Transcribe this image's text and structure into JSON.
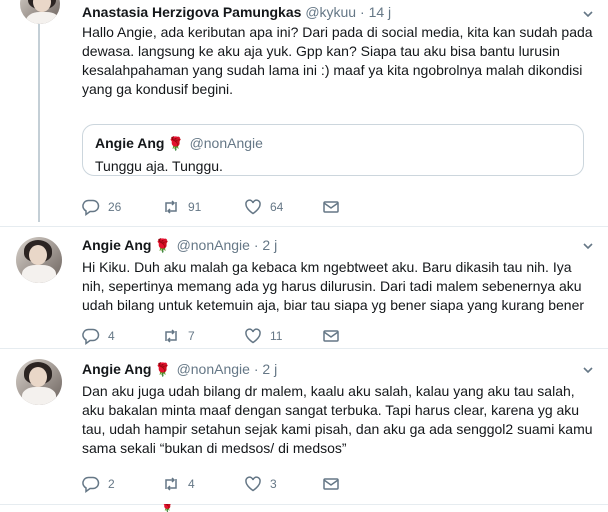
{
  "tweets": [
    {
      "name": "Anastasia Herzigova Pamungkas",
      "handle": "@kykuu",
      "time": "14 j",
      "text": "Hallo Angie, ada keributan apa ini? Dari pada di social media, kita kan sudah pada dewasa. langsung ke aku aja yuk. Gpp kan? Siapa tau aku bisa bantu lurusin kesalahpahaman yang sudah lama ini :) maaf ya kita ngobrolnya malah dikondisi yang ga kondusif begini.",
      "quote": {
        "name": "Angie Ang",
        "handle": "@nonAngie",
        "text": "Tunggu aja. Tunggu."
      },
      "replies": "26",
      "retweets": "91",
      "likes": "64"
    },
    {
      "name": "Angie Ang",
      "handle": "@nonAngie",
      "time": "2 j",
      "text": "Hi Kiku. Duh aku malah ga kebaca km ngebtweet aku. Baru dikasih tau nih. Iya nih, sepertinya memang ada yg harus dilurusin. Dari tadi malem sebenernya aku udah bilang untuk ketemuin aja, biar tau siapa yg bener siapa yang kurang bener",
      "replies": "4",
      "retweets": "7",
      "likes": "11"
    },
    {
      "name": "Angie Ang",
      "handle": "@nonAngie",
      "time": "2 j",
      "text": "Dan aku juga udah bilang dr malem, kaalu aku salah, kalau yang aku tau salah, aku bakalan minta maaf dengan sangat terbuka. Tapi harus clear, karena yg aku tau, udah hampir setahun sejak kami pisah, dan aku ga ada senggol2 suami kamu sama sekali “bukan di medsos/ di medsos”",
      "replies": "2",
      "retweets": "4",
      "likes": "3"
    }
  ],
  "separator": "·",
  "icons": {
    "reply": "reply-icon",
    "retweet": "retweet-icon",
    "like": "heart-icon",
    "dm": "envelope-icon",
    "caret": "chevron-down-icon",
    "rose": "rose-emoji"
  },
  "colors": {
    "text": "#14171a",
    "muted": "#657786",
    "rose": "#c4122f",
    "line": "#c4cfd6",
    "border": "#e6ecf0"
  }
}
